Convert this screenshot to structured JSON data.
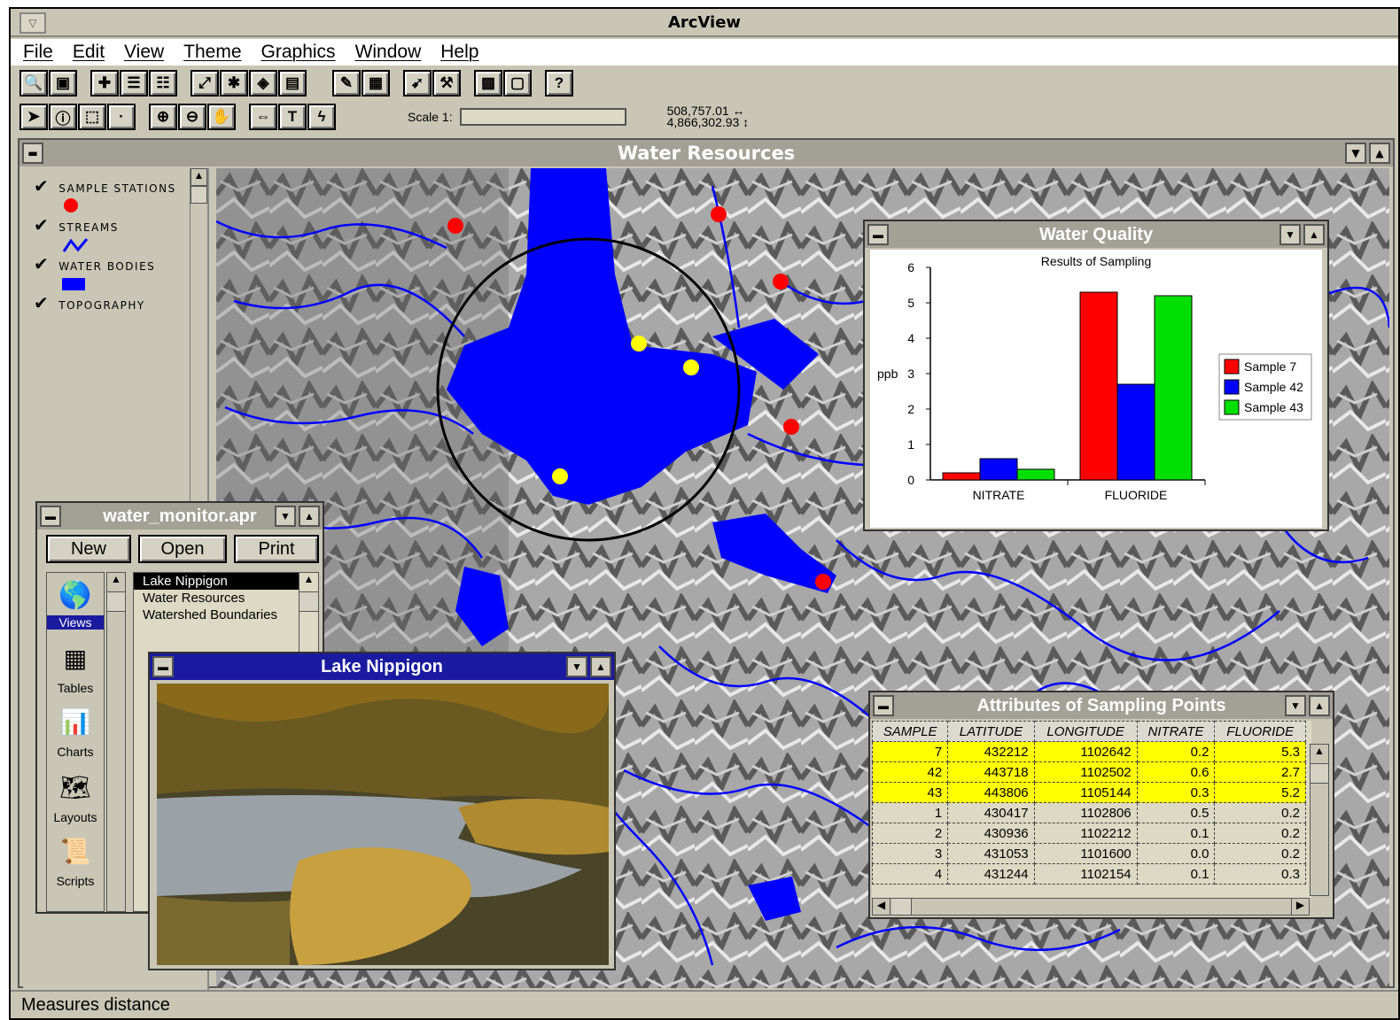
{
  "app": {
    "title": "ArcView"
  },
  "menu": [
    "File",
    "Edit",
    "View",
    "Theme",
    "Graphics",
    "Window",
    "Help"
  ],
  "toolbar": {
    "scale_label": "Scale 1:",
    "coord_x": "508,757.01 ↔",
    "coord_y": "4,866,302.93 ↕"
  },
  "view": {
    "title": "Water Resources",
    "legend": [
      {
        "label": "SAMPLE STATIONS",
        "symbol": "red-dot"
      },
      {
        "label": "STREAMS",
        "symbol": "blue-line"
      },
      {
        "label": "WATER BODIES",
        "symbol": "blue-rect"
      },
      {
        "label": "TOPOGRAPHY",
        "symbol": "none"
      }
    ]
  },
  "project": {
    "title": "water_monitor.apr",
    "buttons": [
      "New",
      "Open",
      "Print"
    ],
    "doc_types": [
      "Views",
      "Tables",
      "Charts",
      "Layouts",
      "Scripts"
    ],
    "selected_type": "Views",
    "views": [
      "Lake Nippigon",
      "Water Resources",
      "Watershed Boundaries"
    ],
    "selected_view": "Lake Nippigon"
  },
  "photo": {
    "title": "Lake Nippigon"
  },
  "chart": {
    "window_title": "Water Quality"
  },
  "chart_data": {
    "type": "bar",
    "title": "Results of Sampling",
    "ylabel": "ppb",
    "categories": [
      "NITRATE",
      "FLUORIDE"
    ],
    "ylim": [
      0,
      6
    ],
    "yticks": [
      "0",
      "1",
      "2",
      "3",
      "4",
      "5",
      "6"
    ],
    "legend_position": "right",
    "series": [
      {
        "name": "Sample 7",
        "color": "#ff0000",
        "values": [
          0.2,
          5.3
        ]
      },
      {
        "name": "Sample 42",
        "color": "#0000ff",
        "values": [
          0.6,
          2.7
        ]
      },
      {
        "name": "Sample 43",
        "color": "#00e000",
        "values": [
          0.3,
          5.2
        ]
      }
    ]
  },
  "attributes": {
    "title": "Attributes of Sampling Points",
    "columns": [
      "SAMPLE",
      "LATITUDE",
      "LONGITUDE",
      "NITRATE",
      "FLUORIDE"
    ],
    "rows": [
      {
        "cells": [
          "7",
          "432212",
          "1102642",
          "0.2",
          "5.3"
        ],
        "highlight": true
      },
      {
        "cells": [
          "42",
          "443718",
          "1102502",
          "0.6",
          "2.7"
        ],
        "highlight": true
      },
      {
        "cells": [
          "43",
          "443806",
          "1105144",
          "0.3",
          "5.2"
        ],
        "highlight": true
      },
      {
        "cells": [
          "1",
          "430417",
          "1102806",
          "0.5",
          "0.2"
        ],
        "highlight": false
      },
      {
        "cells": [
          "2",
          "430936",
          "1102212",
          "0.1",
          "0.2"
        ],
        "highlight": false
      },
      {
        "cells": [
          "3",
          "431053",
          "1101600",
          "0.0",
          "0.2"
        ],
        "highlight": false
      },
      {
        "cells": [
          "4",
          "431244",
          "1102154",
          "0.1",
          "0.3"
        ],
        "highlight": false
      }
    ]
  },
  "status": {
    "text": "Measures distance"
  }
}
